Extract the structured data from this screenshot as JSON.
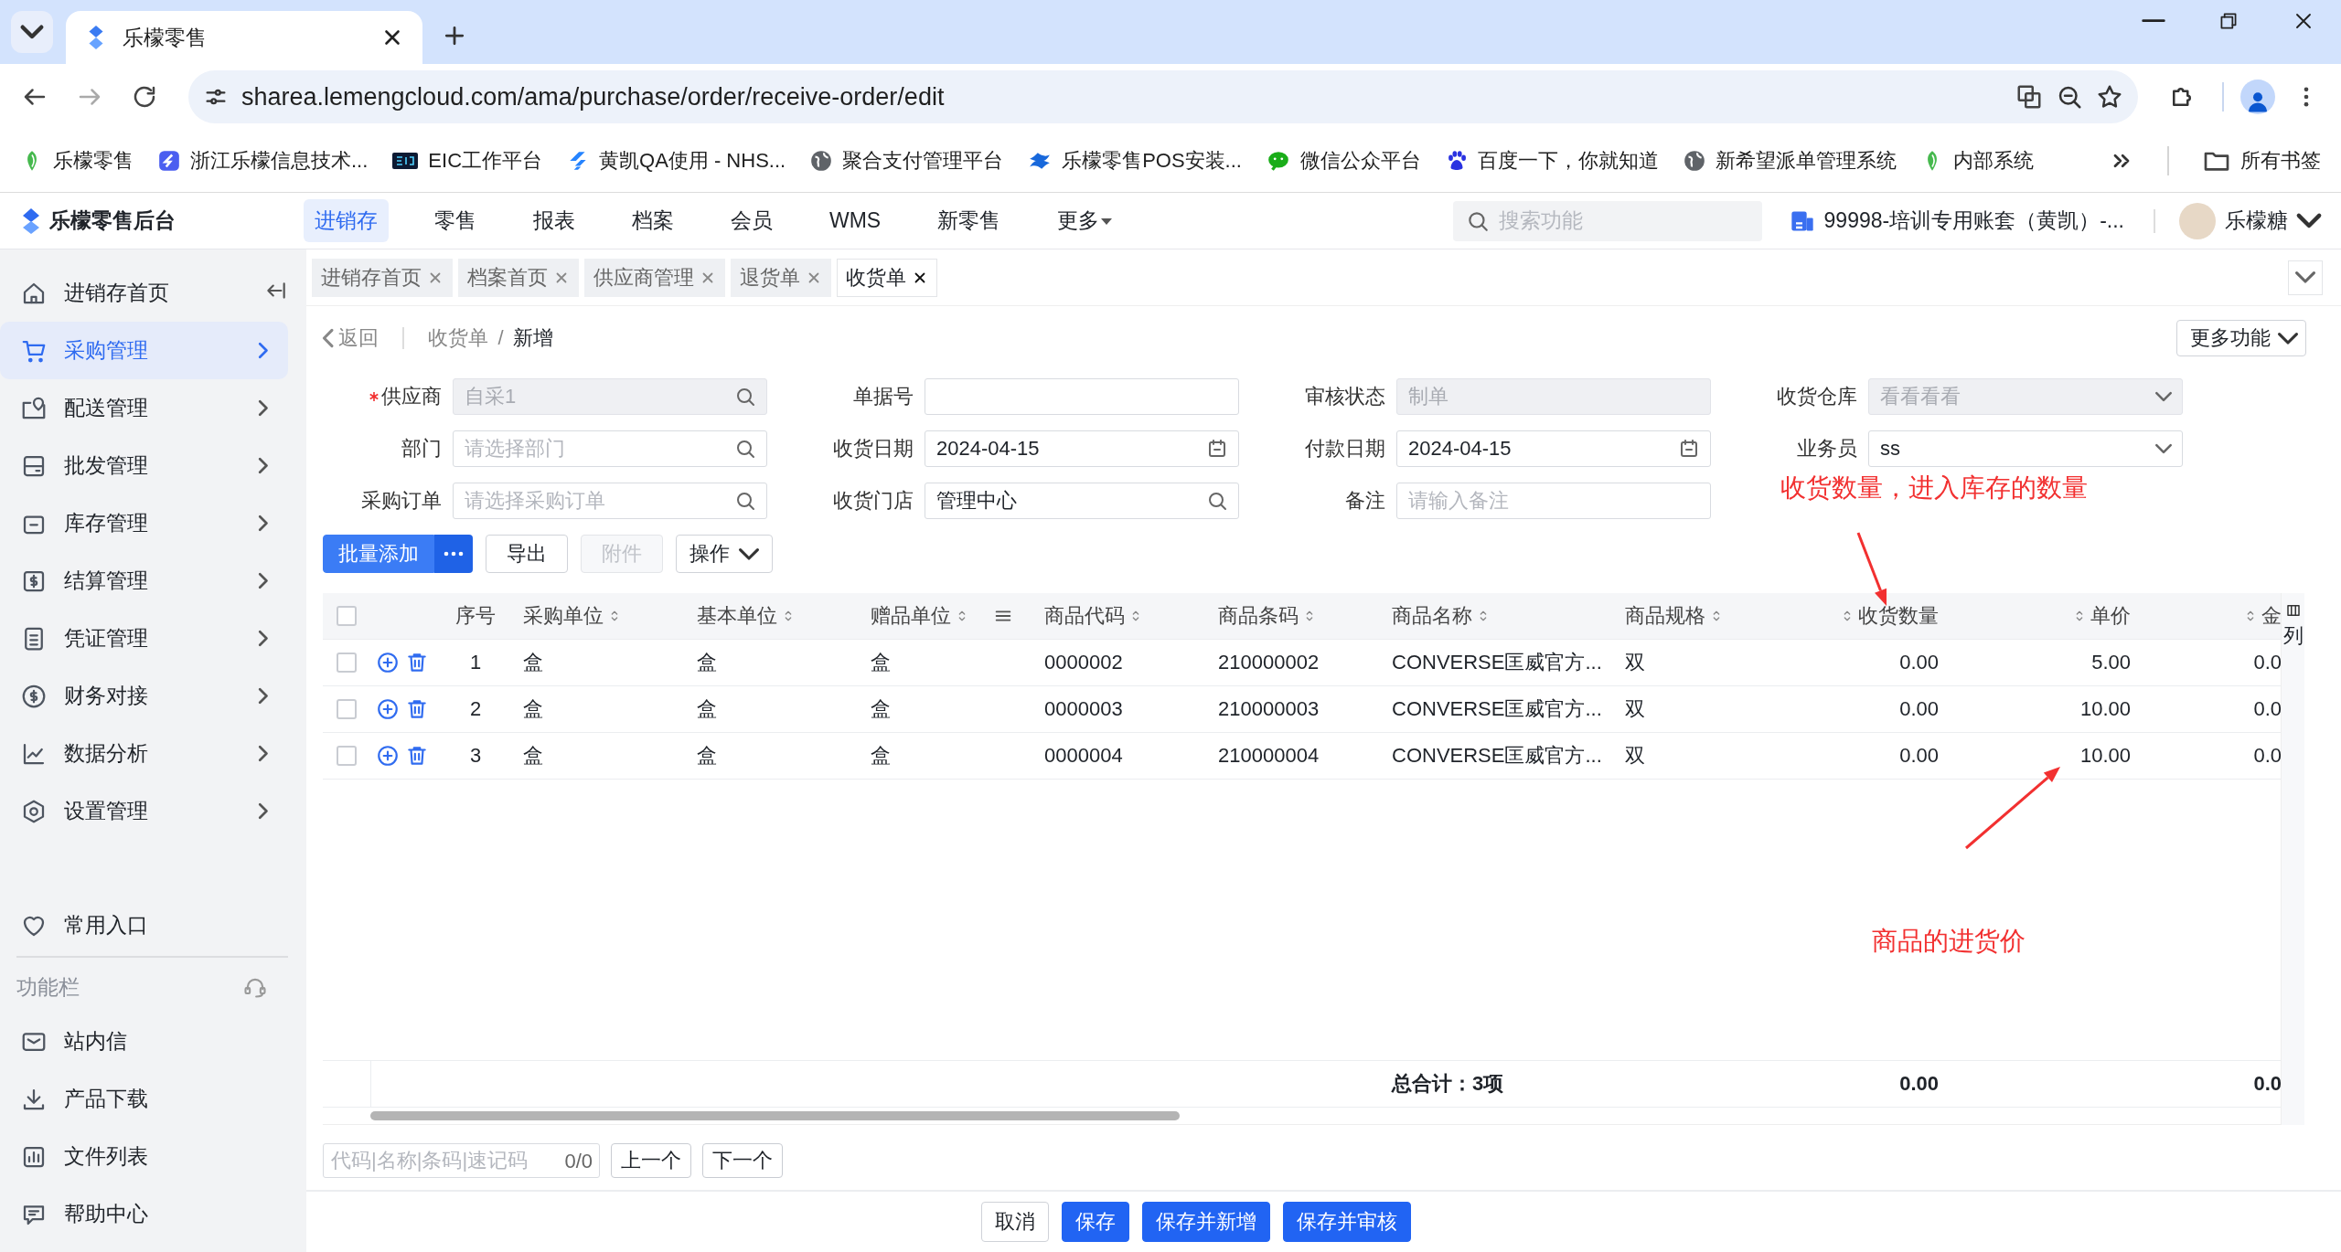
{
  "browser": {
    "tab_title": "乐檬零售",
    "url": "sharea.lemengcloud.com/ama/purchase/order/receive-order/edit",
    "bookmarks": [
      {
        "label": "乐檬零售"
      },
      {
        "label": "浙江乐檬信息技术..."
      },
      {
        "label": "EIC工作平台"
      },
      {
        "label": "黄凯QA使用 - NHS..."
      },
      {
        "label": "聚合支付管理平台"
      },
      {
        "label": "乐檬零售POS安装..."
      },
      {
        "label": "微信公众平台"
      },
      {
        "label": "百度一下，你就知道"
      },
      {
        "label": "新希望派单管理系统"
      },
      {
        "label": "内部系统"
      }
    ],
    "all_bookmarks": "所有书签"
  },
  "app": {
    "title": "乐檬零售后台",
    "nav": [
      {
        "label": "进销存",
        "selected": true,
        "kind": "link"
      },
      {
        "label": "零售",
        "selected": false,
        "kind": "link"
      },
      {
        "label": "报表",
        "selected": false,
        "kind": "link"
      },
      {
        "label": "档案",
        "selected": false,
        "kind": "link"
      },
      {
        "label": "会员",
        "selected": false,
        "kind": "link"
      },
      {
        "label": "WMS",
        "selected": false,
        "kind": "link"
      },
      {
        "label": "新零售",
        "selected": false,
        "kind": "link"
      },
      {
        "label": "更多",
        "selected": false,
        "kind": "dropdown"
      }
    ],
    "search_placeholder": "搜索功能",
    "account": "99998-培训专用账套（黄凯）-...",
    "user": "乐檬糖"
  },
  "sidebar": {
    "items": [
      {
        "label": "进销存首页",
        "selected": false,
        "has_children": false
      },
      {
        "label": "采购管理",
        "selected": true,
        "has_children": true
      },
      {
        "label": "配送管理",
        "selected": false,
        "has_children": true
      },
      {
        "label": "批发管理",
        "selected": false,
        "has_children": true
      },
      {
        "label": "库存管理",
        "selected": false,
        "has_children": true
      },
      {
        "label": "结算管理",
        "selected": false,
        "has_children": true
      },
      {
        "label": "凭证管理",
        "selected": false,
        "has_children": true
      },
      {
        "label": "财务对接",
        "selected": false,
        "has_children": true
      },
      {
        "label": "数据分析",
        "selected": false,
        "has_children": true
      },
      {
        "label": "设置管理",
        "selected": false,
        "has_children": true
      }
    ],
    "favorites": "常用入口",
    "section_title": "功能栏",
    "tools": [
      {
        "label": "站内信"
      },
      {
        "label": "产品下载"
      },
      {
        "label": "文件列表"
      },
      {
        "label": "帮助中心"
      }
    ]
  },
  "page_tabs": [
    {
      "label": "进销存首页",
      "selected": false
    },
    {
      "label": "档案首页",
      "selected": false
    },
    {
      "label": "供应商管理",
      "selected": false
    },
    {
      "label": "退货单",
      "selected": false
    },
    {
      "label": "收货单",
      "selected": true
    }
  ],
  "breadcrumb": {
    "back": "返回",
    "items": [
      "收货单",
      "新增"
    ],
    "separator": "/"
  },
  "more_button": "更多功能",
  "form": [
    {
      "label": "供应商",
      "kind": "search",
      "required": true,
      "disabled": true,
      "value": "自采1"
    },
    {
      "label": "单据号",
      "kind": "text",
      "required": false,
      "disabled": false
    },
    {
      "label": "审核状态",
      "kind": "text",
      "required": false,
      "disabled": true,
      "value": "制单"
    },
    {
      "label": "收货仓库",
      "kind": "select",
      "required": false,
      "disabled": true,
      "value": "看看看看"
    },
    {
      "label": "部门",
      "kind": "search",
      "required": false,
      "disabled": false,
      "placeholder": "请选择部门"
    },
    {
      "label": "收货日期",
      "kind": "date",
      "required": false,
      "disabled": false,
      "value": "2024-04-15"
    },
    {
      "label": "付款日期",
      "kind": "date",
      "required": false,
      "disabled": false,
      "value": "2024-04-15"
    },
    {
      "label": "业务员",
      "kind": "select",
      "required": false,
      "disabled": false,
      "value": "ss"
    },
    {
      "label": "采购订单",
      "kind": "search",
      "required": false,
      "disabled": false,
      "placeholder": "请选择采购订单"
    },
    {
      "label": "收货门店",
      "kind": "search",
      "required": false,
      "disabled": false,
      "value": "管理中心"
    },
    {
      "label": "备注",
      "kind": "text",
      "required": false,
      "disabled": false,
      "placeholder": "请输入备注"
    }
  ],
  "toolbar": [
    {
      "label": "批量添加",
      "kind": "split",
      "disabled": false
    },
    {
      "label": "导出",
      "kind": "plain",
      "disabled": false
    },
    {
      "label": "附件",
      "kind": "plain",
      "disabled": true
    },
    {
      "label": "操作",
      "kind": "dropdown",
      "disabled": false
    }
  ],
  "table": {
    "select_all": {
      "checked": false
    },
    "columns": [
      {
        "label": "序号",
        "sortable": false,
        "menu": false
      },
      {
        "label": "采购单位",
        "sortable": true,
        "menu": false
      },
      {
        "label": "基本单位",
        "sortable": true,
        "menu": false
      },
      {
        "label": "赠品单位",
        "sortable": true,
        "menu": true
      },
      {
        "label": "商品代码",
        "sortable": true,
        "menu": false
      },
      {
        "label": "商品条码",
        "sortable": true,
        "menu": false
      },
      {
        "label": "商品名称",
        "sortable": true,
        "menu": false
      },
      {
        "label": "商品规格",
        "sortable": true,
        "menu": false
      },
      {
        "label": "收货数量",
        "sortable": true,
        "menu": false
      },
      {
        "label": "单价",
        "sortable": true,
        "menu": false
      },
      {
        "label": "金",
        "sortable": true,
        "menu": false
      }
    ],
    "rows": [
      {
        "checked": false,
        "cells": [
          "1",
          "盒",
          "盒",
          "盒",
          "0000002",
          "210000002",
          "CONVERSE匡威官方...",
          "双",
          "0.00",
          "5.00",
          "0.0"
        ]
      },
      {
        "checked": false,
        "cells": [
          "2",
          "盒",
          "盒",
          "盒",
          "0000003",
          "210000003",
          "CONVERSE匡威官方...",
          "双",
          "0.00",
          "10.00",
          "0.0"
        ]
      },
      {
        "checked": false,
        "cells": [
          "3",
          "盒",
          "盒",
          "盒",
          "0000004",
          "210000004",
          "CONVERSE匡威官方...",
          "双",
          "0.00",
          "10.00",
          "0.0"
        ]
      }
    ],
    "footer": {
      "label": "总合计：3项",
      "quantity": "0.00",
      "amount": "0.0"
    },
    "column_settings": "列"
  },
  "finder": {
    "placeholder": "代码|名称|条码|速记码",
    "count": "0/0",
    "prev": "上一个",
    "next": "下一个"
  },
  "actions": [
    {
      "label": "取消",
      "kind": "default"
    },
    {
      "label": "保存",
      "kind": "primary"
    },
    {
      "label": "保存并新增",
      "kind": "primary"
    },
    {
      "label": "保存并审核",
      "kind": "primary"
    }
  ],
  "annotations": [
    {
      "text": "收货数量，进入库存的数量"
    },
    {
      "text": "商品的进货价"
    }
  ]
}
